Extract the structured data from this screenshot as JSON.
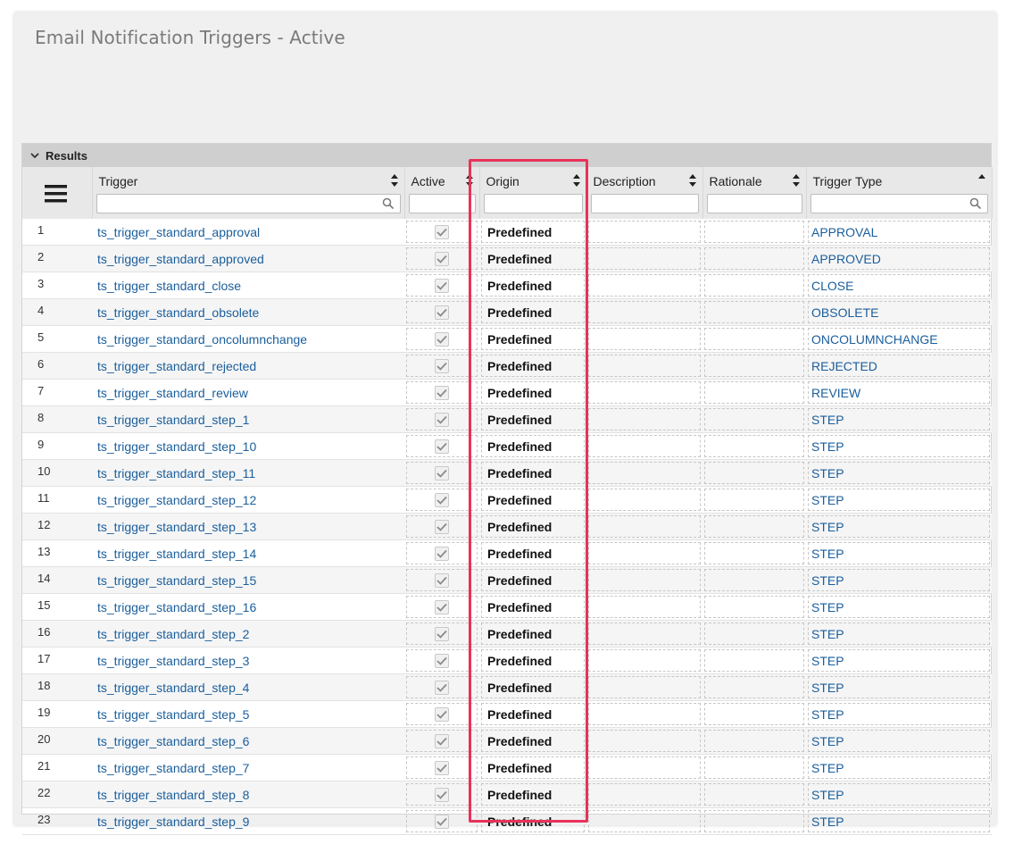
{
  "page": {
    "title": "Email Notification Triggers - Active"
  },
  "results": {
    "label": "Results"
  },
  "columns": {
    "trigger": "Trigger",
    "active": "Active",
    "origin": "Origin",
    "description": "Description",
    "rationale": "Rationale",
    "trigger_type": "Trigger Type"
  },
  "colors": {
    "link": "#1a5e9c",
    "highlight": "#e8325a",
    "header": "#cfcfcf"
  },
  "rows": [
    {
      "n": "1",
      "trigger": "ts_trigger_standard_approval",
      "active": true,
      "origin": "Predefined",
      "type": "APPROVAL"
    },
    {
      "n": "2",
      "trigger": "ts_trigger_standard_approved",
      "active": true,
      "origin": "Predefined",
      "type": "APPROVED"
    },
    {
      "n": "3",
      "trigger": "ts_trigger_standard_close",
      "active": true,
      "origin": "Predefined",
      "type": "CLOSE"
    },
    {
      "n": "4",
      "trigger": "ts_trigger_standard_obsolete",
      "active": true,
      "origin": "Predefined",
      "type": "OBSOLETE"
    },
    {
      "n": "5",
      "trigger": "ts_trigger_standard_oncolumnchange",
      "active": true,
      "origin": "Predefined",
      "type": "ONCOLUMNCHANGE"
    },
    {
      "n": "6",
      "trigger": "ts_trigger_standard_rejected",
      "active": true,
      "origin": "Predefined",
      "type": "REJECTED"
    },
    {
      "n": "7",
      "trigger": "ts_trigger_standard_review",
      "active": true,
      "origin": "Predefined",
      "type": "REVIEW"
    },
    {
      "n": "8",
      "trigger": "ts_trigger_standard_step_1",
      "active": true,
      "origin": "Predefined",
      "type": "STEP"
    },
    {
      "n": "9",
      "trigger": "ts_trigger_standard_step_10",
      "active": true,
      "origin": "Predefined",
      "type": "STEP"
    },
    {
      "n": "10",
      "trigger": "ts_trigger_standard_step_11",
      "active": true,
      "origin": "Predefined",
      "type": "STEP"
    },
    {
      "n": "11",
      "trigger": "ts_trigger_standard_step_12",
      "active": true,
      "origin": "Predefined",
      "type": "STEP"
    },
    {
      "n": "12",
      "trigger": "ts_trigger_standard_step_13",
      "active": true,
      "origin": "Predefined",
      "type": "STEP"
    },
    {
      "n": "13",
      "trigger": "ts_trigger_standard_step_14",
      "active": true,
      "origin": "Predefined",
      "type": "STEP"
    },
    {
      "n": "14",
      "trigger": "ts_trigger_standard_step_15",
      "active": true,
      "origin": "Predefined",
      "type": "STEP"
    },
    {
      "n": "15",
      "trigger": "ts_trigger_standard_step_16",
      "active": true,
      "origin": "Predefined",
      "type": "STEP"
    },
    {
      "n": "16",
      "trigger": "ts_trigger_standard_step_2",
      "active": true,
      "origin": "Predefined",
      "type": "STEP"
    },
    {
      "n": "17",
      "trigger": "ts_trigger_standard_step_3",
      "active": true,
      "origin": "Predefined",
      "type": "STEP"
    },
    {
      "n": "18",
      "trigger": "ts_trigger_standard_step_4",
      "active": true,
      "origin": "Predefined",
      "type": "STEP"
    },
    {
      "n": "19",
      "trigger": "ts_trigger_standard_step_5",
      "active": true,
      "origin": "Predefined",
      "type": "STEP"
    },
    {
      "n": "20",
      "trigger": "ts_trigger_standard_step_6",
      "active": true,
      "origin": "Predefined",
      "type": "STEP"
    },
    {
      "n": "21",
      "trigger": "ts_trigger_standard_step_7",
      "active": true,
      "origin": "Predefined",
      "type": "STEP"
    },
    {
      "n": "22",
      "trigger": "ts_trigger_standard_step_8",
      "active": true,
      "origin": "Predefined",
      "type": "STEP"
    },
    {
      "n": "23",
      "trigger": "ts_trigger_standard_step_9",
      "active": true,
      "origin": "Predefined",
      "type": "STEP"
    }
  ]
}
